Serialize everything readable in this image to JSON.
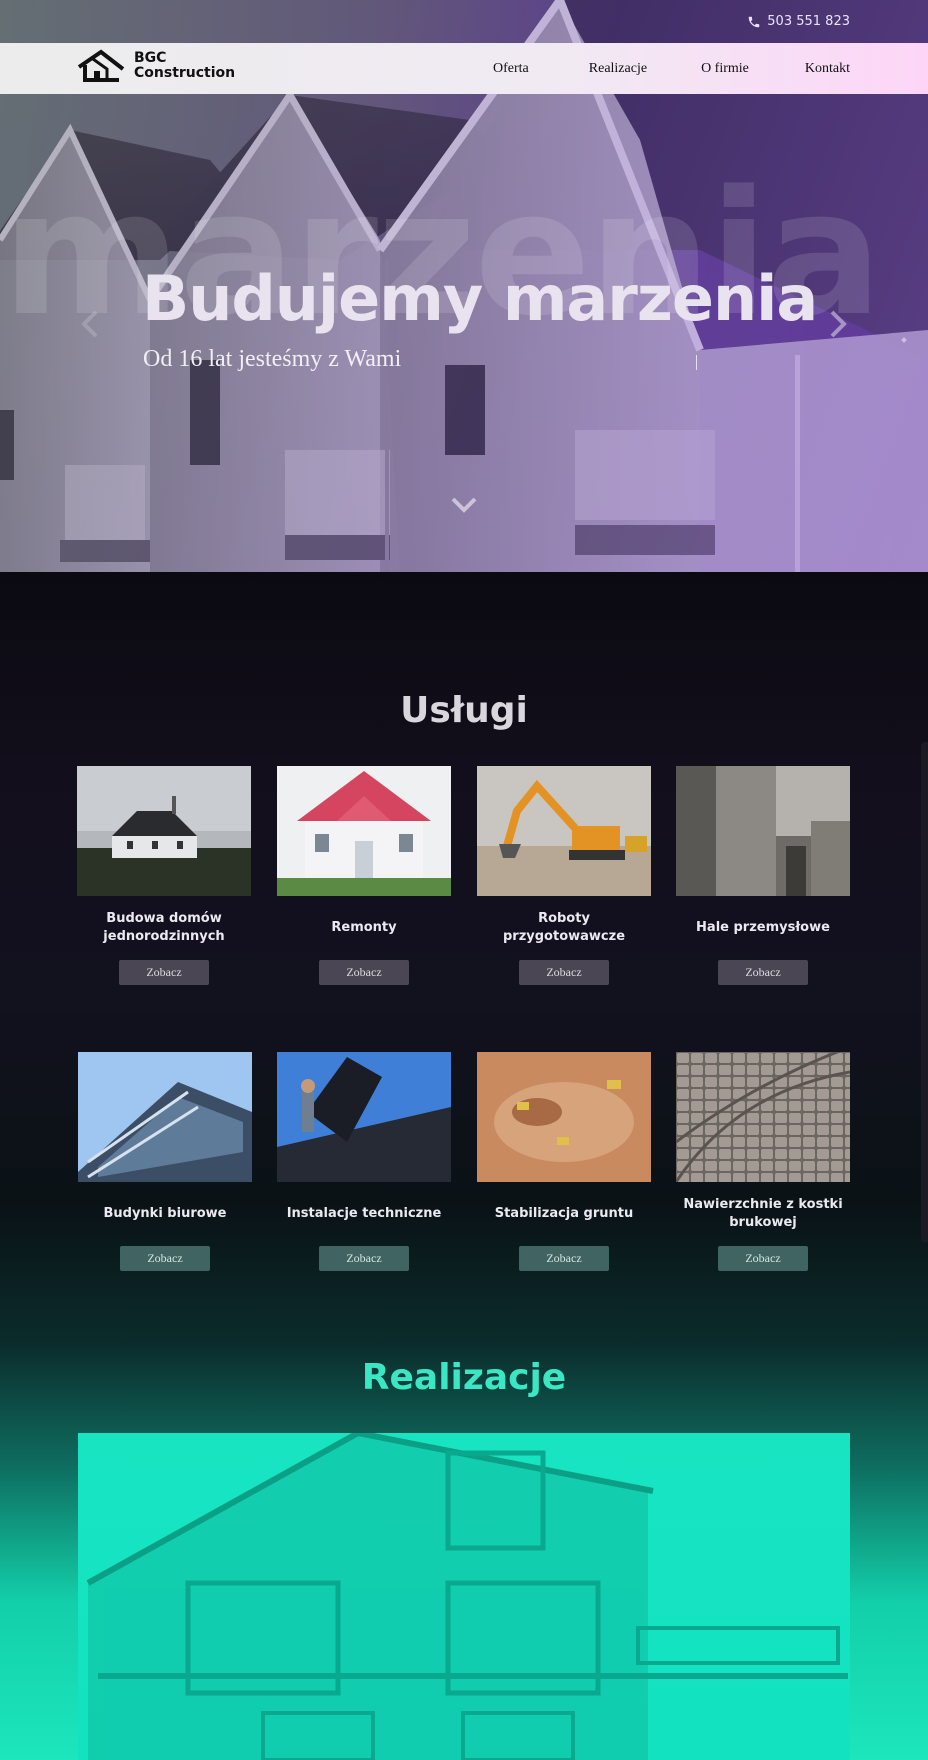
{
  "topbar": {
    "phone": "503 551 823",
    "phone_icon": "phone-icon"
  },
  "brand": {
    "line1": "BGC",
    "line2": "Construction",
    "logo_icon": "house-roof-icon"
  },
  "nav": {
    "items": [
      "Oferta",
      "Realizacje",
      "O firmie",
      "Kontakt"
    ]
  },
  "hero": {
    "background_word": "marzenia",
    "title": "Budujemy marzenia",
    "subtitle": "Od 16 lat jesteśmy z Wami",
    "prev_icon": "chevron-left-icon",
    "next_icon": "chevron-right-icon",
    "scroll_icon": "chevron-down-icon"
  },
  "services": {
    "title": "Usługi",
    "button_label": "Zobacz",
    "items": [
      {
        "label": "Budowa domów jednorodzinnych"
      },
      {
        "label": "Remonty"
      },
      {
        "label": "Roboty przygotowawcze"
      },
      {
        "label": "Hale przemysłowe"
      },
      {
        "label": "Budynki biurowe"
      },
      {
        "label": "Instalacje techniczne"
      },
      {
        "label": "Stabilizacja gruntu"
      },
      {
        "label": "Nawierzchnie z kostki brukowej"
      }
    ]
  },
  "realizacje": {
    "title": "Realizacje"
  },
  "colors": {
    "hero_purple": "#4b2f7a",
    "nav_pink": "#fdd6f7",
    "teal_accent": "#3be6c4",
    "dark_bg": "#0b0a12"
  }
}
